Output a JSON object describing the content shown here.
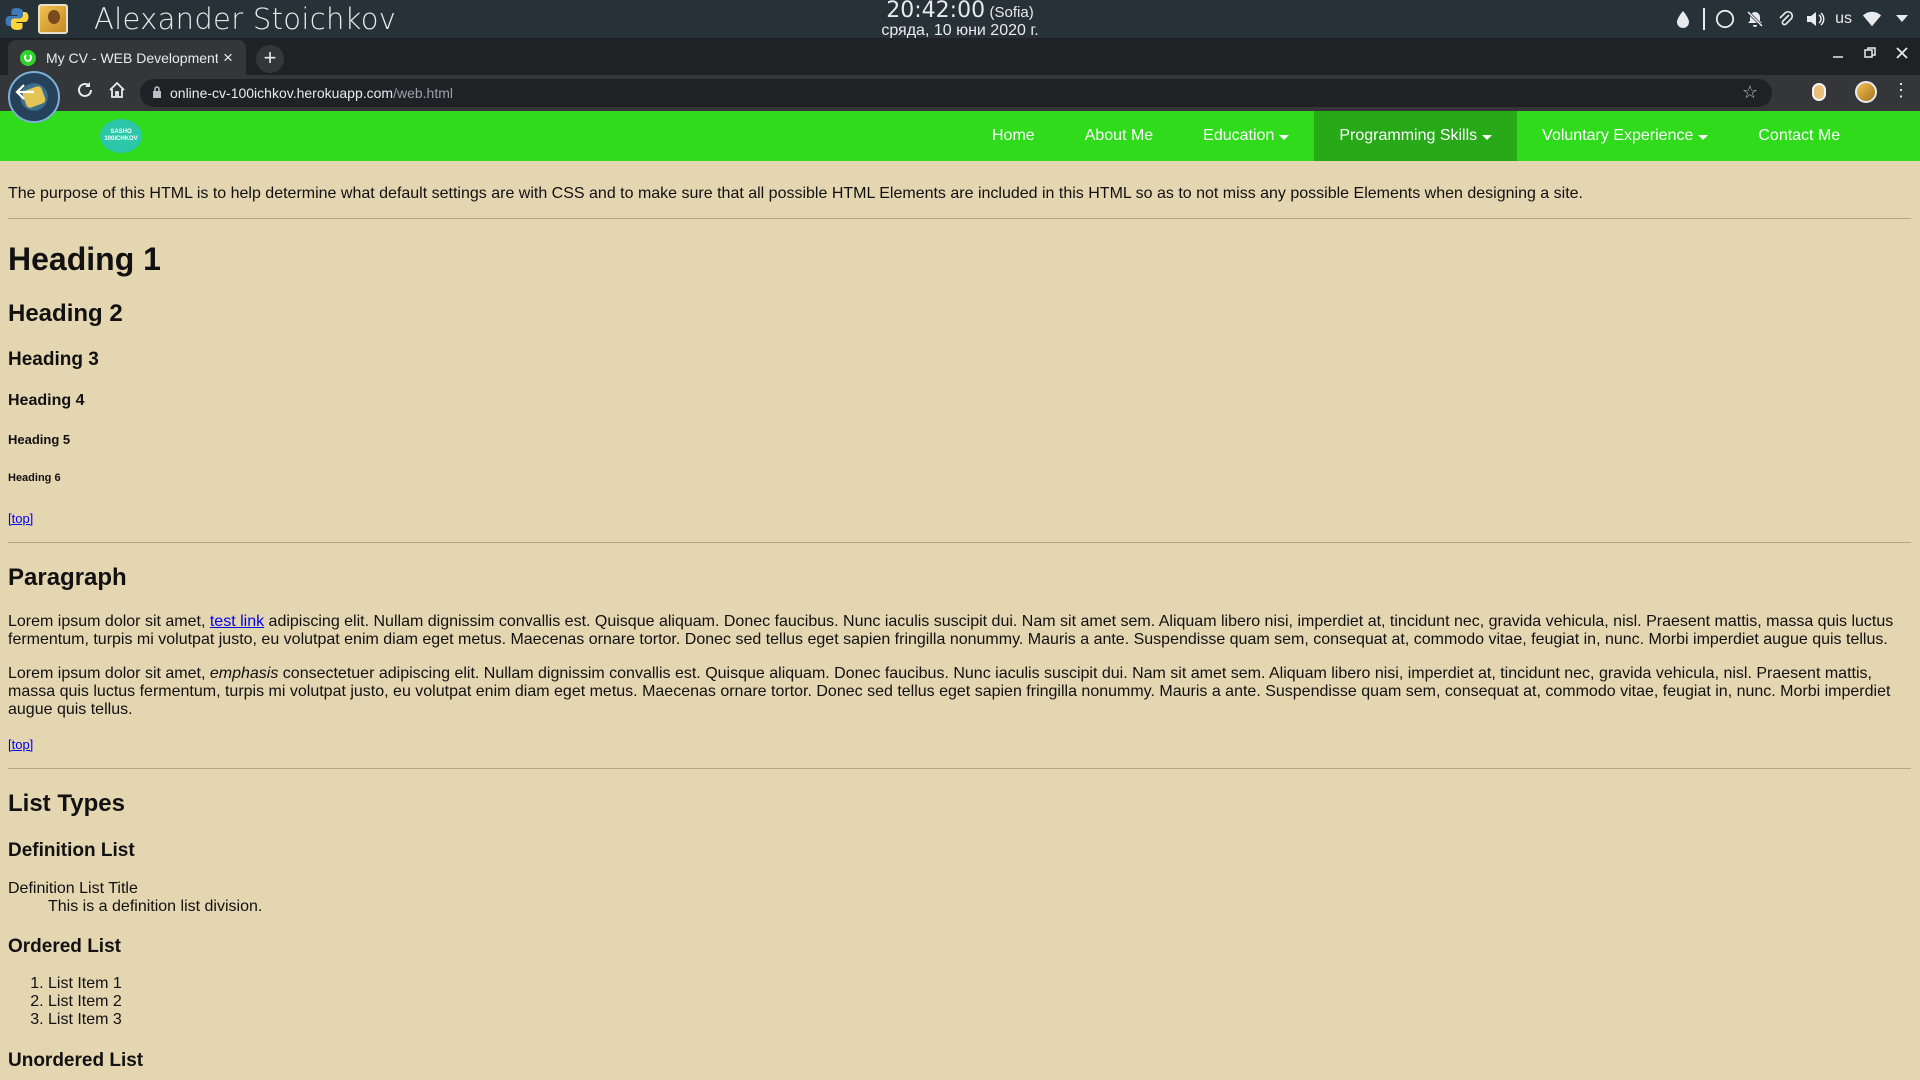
{
  "os": {
    "user": "Alexander Stoichkov",
    "time": "20:42:00",
    "timezone": "(Sofia)",
    "date": "сряда, 10 юни 2020 г.",
    "keyboard_layout": "us",
    "tray_icons": [
      "drop-icon",
      "circle-icon",
      "bell-off-icon",
      "paperclip-icon",
      "volume-icon",
      "wifi-icon",
      "chevron-down-icon"
    ]
  },
  "browser": {
    "tab_title": "My CV - WEB Development",
    "tab_close": "×",
    "new_tab": "+",
    "url_host": "online-cv-100ichkov.herokuapp.com",
    "url_path": "/web.html"
  },
  "site": {
    "logo_text": "SASHO 100ICHKOV",
    "nav": [
      {
        "label": "Home",
        "dropdown": false,
        "active": false
      },
      {
        "label": "About Me",
        "dropdown": false,
        "active": false
      },
      {
        "label": "Education",
        "dropdown": true,
        "active": false
      },
      {
        "label": "Programming Skills",
        "dropdown": true,
        "active": true
      },
      {
        "label": "Voluntary Experience",
        "dropdown": true,
        "active": false
      },
      {
        "label": "Contact Me",
        "dropdown": false,
        "active": false
      }
    ],
    "colors": {
      "nav_bg": "#2fdb1a",
      "nav_active": "#27a918",
      "page_bg": "#e5d6b2",
      "link": "#0000ee"
    }
  },
  "content": {
    "intro": "The purpose of this HTML is to help determine what default settings are with CSS and to make sure that all possible HTML Elements are included in this HTML so as to not miss any possible Elements when designing a site.",
    "h1": "Heading 1",
    "h2": "Heading 2",
    "h3": "Heading 3",
    "h4": "Heading 4",
    "h5": "Heading 5",
    "h6": "Heading 6",
    "top_link": "[top]",
    "paragraph_heading": "Paragraph",
    "p1_start": "Lorem ipsum dolor sit amet, ",
    "p1_link": "test link",
    "p1_rest": " adipiscing elit. Nullam dignissim convallis est. Quisque aliquam. Donec faucibus. Nunc iaculis suscipit dui. Nam sit amet sem. Aliquam libero nisi, imperdiet at, tincidunt nec, gravida vehicula, nisl. Praesent mattis, massa quis luctus fermentum, turpis mi volutpat justo, eu volutpat enim diam eget metus. Maecenas ornare tortor. Donec sed tellus eget sapien fringilla nonummy. Mauris a ante. Suspendisse quam sem, consequat at, commodo vitae, feugiat in, nunc. Morbi imperdiet augue quis tellus.",
    "p2_start": "Lorem ipsum dolor sit amet, ",
    "p2_em": "emphasis",
    "p2_rest": " consectetuer adipiscing elit. Nullam dignissim convallis est. Quisque aliquam. Donec faucibus. Nunc iaculis suscipit dui. Nam sit amet sem. Aliquam libero nisi, imperdiet at, tincidunt nec, gravida vehicula, nisl. Praesent mattis, massa quis luctus fermentum, turpis mi volutpat justo, eu volutpat enim diam eget metus. Maecenas ornare tortor. Donec sed tellus eget sapien fringilla nonummy. Mauris a ante. Suspendisse quam sem, consequat at, commodo vitae, feugiat in, nunc. Morbi imperdiet augue quis tellus.",
    "list_types_heading": "List Types",
    "definition_list_heading": "Definition List",
    "dt": "Definition List Title",
    "dd": "This is a definition list division.",
    "ordered_list_heading": "Ordered List",
    "ordered_items": [
      "List Item 1",
      "List Item 2",
      "List Item 3"
    ],
    "unordered_list_heading": "Unordered List"
  }
}
